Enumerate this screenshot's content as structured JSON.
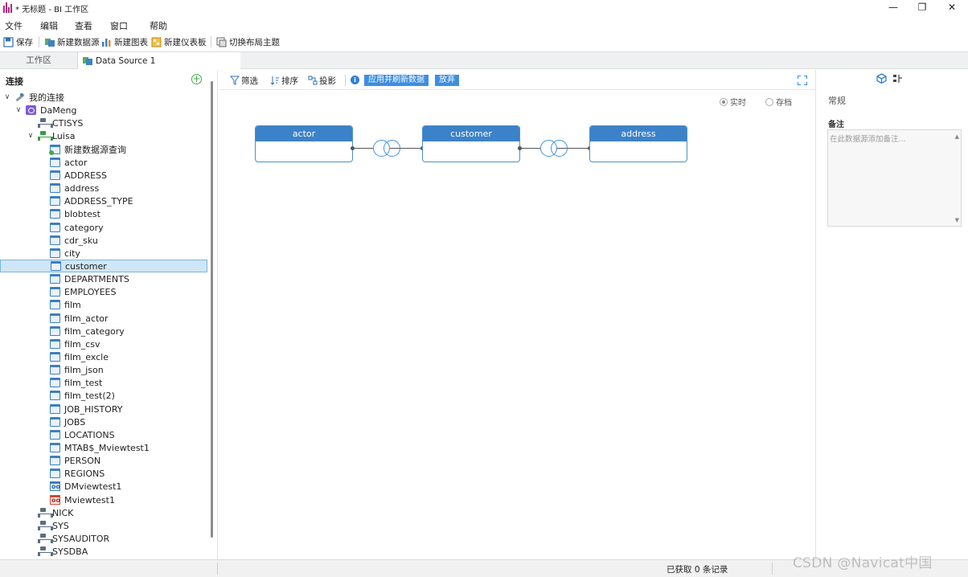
{
  "window": {
    "title": "* 无标题 - BI 工作区",
    "minimize_glyph": "—",
    "restore_glyph": "❐",
    "close_glyph": "✕"
  },
  "menu": [
    "文件",
    "编辑",
    "查看",
    "窗口",
    "帮助"
  ],
  "toolbar": {
    "save": "保存",
    "new_datasource": "新建数据源",
    "new_chart": "新建图表",
    "new_dashboard": "新建仪表板",
    "switch_theme": "切换布局主题"
  },
  "tabs": {
    "workspace": "工作区",
    "datasource": "Data Source 1"
  },
  "left": {
    "header": "连接",
    "add_icon": "+",
    "tree": [
      {
        "label": "我的连接",
        "icon": "conn",
        "twisty": "∨"
      },
      {
        "label": "DaMeng",
        "icon": "db",
        "twisty": "∨"
      },
      {
        "label": "CTISYS",
        "icon": "server"
      },
      {
        "label": "Luisa",
        "icon": "server-green",
        "twisty": "∨"
      },
      {
        "label": "新建数据源查询",
        "icon": "query"
      },
      {
        "label": "actor",
        "icon": "table"
      },
      {
        "label": "ADDRESS",
        "icon": "table"
      },
      {
        "label": "address",
        "icon": "table"
      },
      {
        "label": "ADDRESS_TYPE",
        "icon": "table"
      },
      {
        "label": "blobtest",
        "icon": "table"
      },
      {
        "label": "category",
        "icon": "table"
      },
      {
        "label": "cdr_sku",
        "icon": "table"
      },
      {
        "label": "city",
        "icon": "table"
      },
      {
        "label": "customer",
        "icon": "table",
        "selected": true
      },
      {
        "label": "DEPARTMENTS",
        "icon": "table"
      },
      {
        "label": "EMPLOYEES",
        "icon": "table"
      },
      {
        "label": "film",
        "icon": "table"
      },
      {
        "label": "film_actor",
        "icon": "table"
      },
      {
        "label": "film_category",
        "icon": "table"
      },
      {
        "label": "film_csv",
        "icon": "table"
      },
      {
        "label": "film_excle",
        "icon": "table"
      },
      {
        "label": "film_json",
        "icon": "table"
      },
      {
        "label": "film_test",
        "icon": "table"
      },
      {
        "label": "film_test(2)",
        "icon": "table"
      },
      {
        "label": "JOB_HISTORY",
        "icon": "table"
      },
      {
        "label": "JOBS",
        "icon": "table"
      },
      {
        "label": "LOCATIONS",
        "icon": "table"
      },
      {
        "label": "MTAB$_Mviewtest1",
        "icon": "table"
      },
      {
        "label": "PERSON",
        "icon": "table"
      },
      {
        "label": "REGIONS",
        "icon": "table"
      },
      {
        "label": "DMviewtest1",
        "icon": "view"
      },
      {
        "label": "Mviewtest1",
        "icon": "mview"
      },
      {
        "label": "NICK",
        "icon": "server"
      },
      {
        "label": "SYS",
        "icon": "server"
      },
      {
        "label": "SYSAUDITOR",
        "icon": "server"
      },
      {
        "label": "SYSDBA",
        "icon": "server"
      }
    ]
  },
  "center": {
    "filter": "筛选",
    "sort": "排序",
    "project": "投影",
    "info_icon": "i",
    "apply_refresh": "应用并刷新数据",
    "discard": "放弃",
    "mode_live": "实时",
    "mode_archive": "存档",
    "nodes": [
      "actor",
      "customer",
      "address"
    ]
  },
  "right": {
    "general": "常规",
    "remark_label": "备注",
    "remark_placeholder": "在此数据源添加备注...",
    "scroll_up": "▲",
    "scroll_down": "▼"
  },
  "status": {
    "records": "已获取 0 条记录",
    "watermark": "CSDN @Navicat中国"
  },
  "colors": {
    "accent": "#3c82c8",
    "button_blue": "#3d8ee0",
    "selection": "#cfe6f7"
  }
}
